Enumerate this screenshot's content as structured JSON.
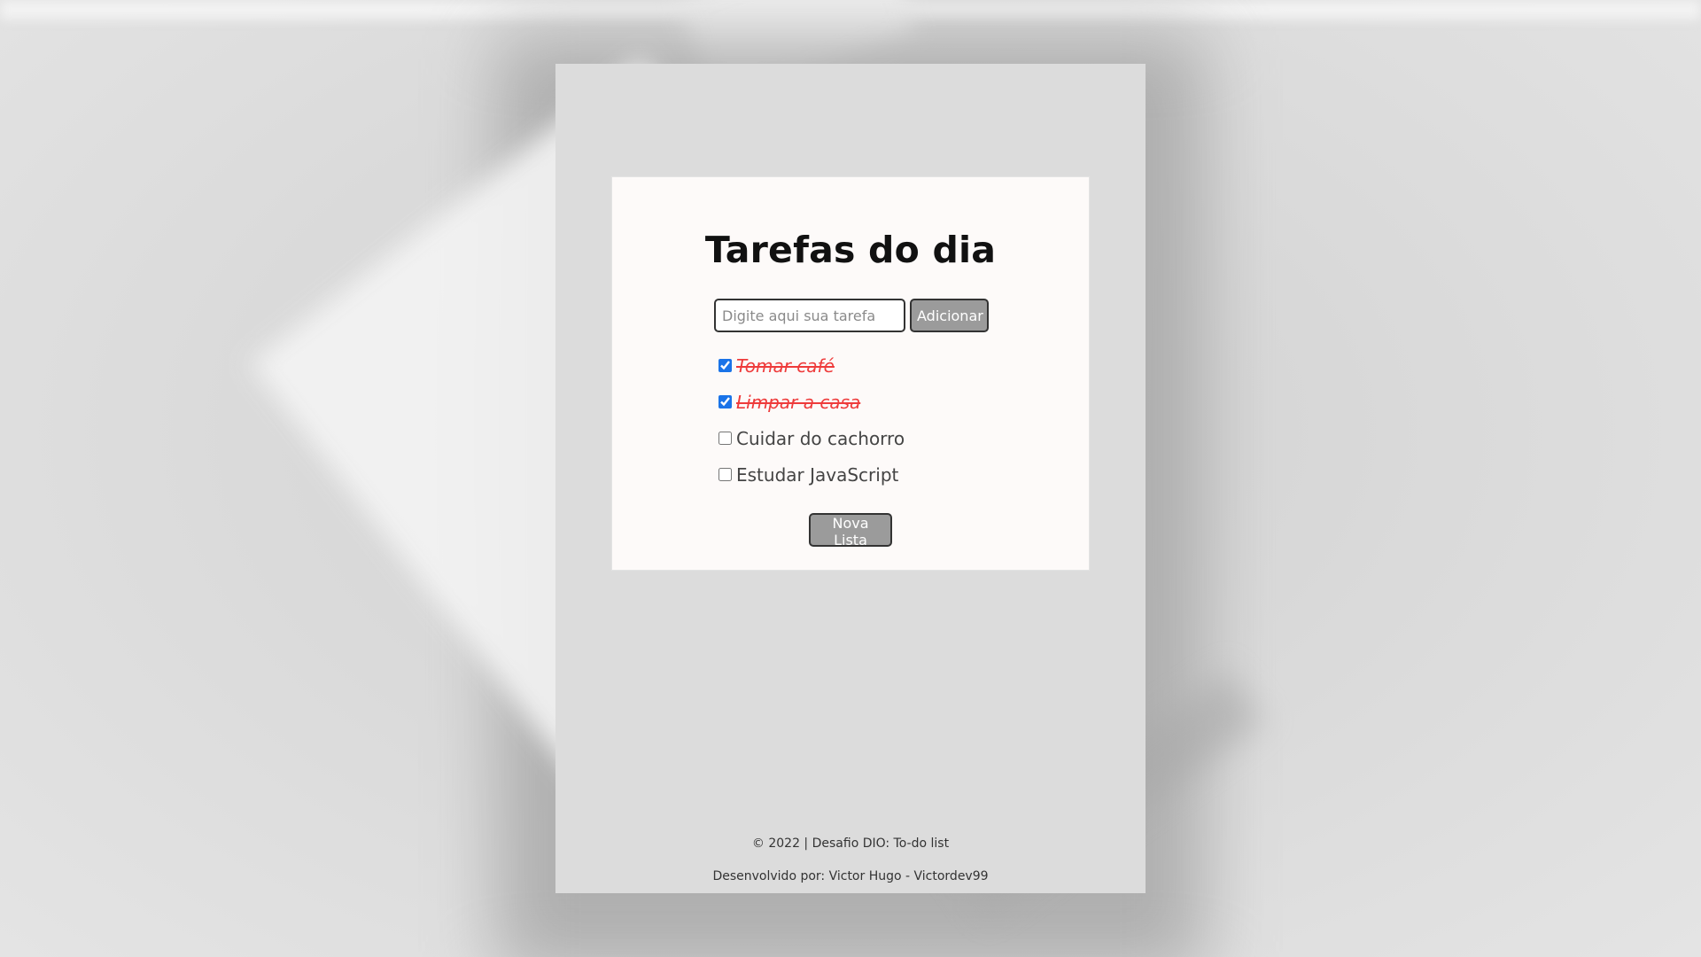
{
  "card": {
    "title": "Tarefas do dia",
    "input_placeholder": "Digite aqui sua tarefa",
    "input_value": "",
    "add_button": "Adicionar",
    "new_list_button": "Nova Lista"
  },
  "tasks": [
    {
      "label": "Tomar café",
      "done": true
    },
    {
      "label": "Limpar a casa",
      "done": true
    },
    {
      "label": "Cuidar do cachorro",
      "done": false
    },
    {
      "label": "Estudar JavaScript",
      "done": false
    }
  ],
  "footer": {
    "copyright": "© 2022 | Desafio DIO: To-do list",
    "credits": "Desenvolvido por: Victor Hugo - Victordev99"
  },
  "colors": {
    "page_bg": "#dcdcdc",
    "card_bg": "#fdfaf9",
    "button_bg": "#9b9b9b",
    "done_text": "#ee3b3b",
    "checkbox_accent": "#1a73e8"
  }
}
